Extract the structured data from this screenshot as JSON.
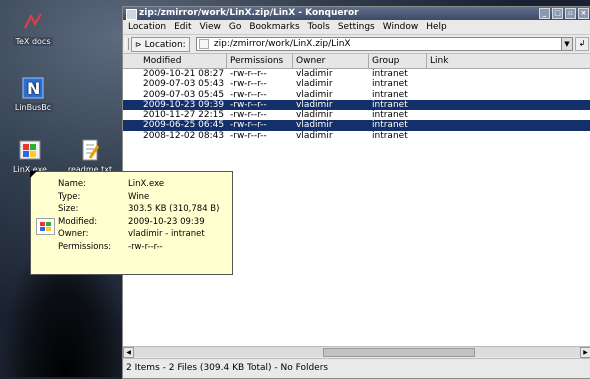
{
  "desktop": {
    "icons": [
      {
        "label": "TeX docs",
        "icon": "tex-docs-icon"
      },
      {
        "label": "LinBusBc",
        "icon": "app-n-icon"
      },
      {
        "label": "LinX.exe",
        "icon": "windows-exe-icon"
      },
      {
        "label": "readme.txt",
        "icon": "text-file-icon"
      }
    ]
  },
  "window": {
    "title": "zip:/zmirror/work/LinX.zip/LinX - Konqueror",
    "menu": [
      "Location",
      "Edit",
      "View",
      "Go",
      "Bookmarks",
      "Tools",
      "Settings",
      "Window",
      "Help"
    ],
    "location_label": "Location:",
    "location_value": "zip:/zmirror/work/LinX.zip/LinX",
    "columns": [
      "Modified",
      "Permissions",
      "Owner",
      "Group",
      "Link"
    ],
    "rows": [
      {
        "modified": "2009-10-21 08:27",
        "permissions": "-rw-r--r--",
        "owner": "vladimir",
        "group": "intranet",
        "link": "",
        "selected": false
      },
      {
        "modified": "2009-07-03 05:43",
        "permissions": "-rw-r--r--",
        "owner": "vladimir",
        "group": "intranet",
        "link": "",
        "selected": false
      },
      {
        "modified": "2009-07-03 05:45",
        "permissions": "-rw-r--r--",
        "owner": "vladimir",
        "group": "intranet",
        "link": "",
        "selected": false
      },
      {
        "modified": "2009-10-23 09:39",
        "permissions": "-rw-r--r--",
        "owner": "vladimir",
        "group": "intranet",
        "link": "",
        "selected": true
      },
      {
        "modified": "2010-11-27 22:15",
        "permissions": "-rw-r--r--",
        "owner": "vladimir",
        "group": "intranet",
        "link": "",
        "selected": false
      },
      {
        "modified": "2009-06-25 06:45",
        "permissions": "-rw-r--r--",
        "owner": "vladimir",
        "group": "intranet",
        "link": "",
        "selected": true
      },
      {
        "modified": "2008-12-02 08:43",
        "permissions": "-rw-r--r--",
        "owner": "vladimir",
        "group": "intranet",
        "link": "",
        "selected": false
      }
    ],
    "status": "2 Items - 2 Files (309.4 KB Total) - No Folders"
  },
  "tooltip": {
    "fields": [
      {
        "key": "Name:",
        "value": "LinX.exe"
      },
      {
        "key": "Type:",
        "value": "Wine"
      },
      {
        "key": "Size:",
        "value": "303.5 KB (310,784 B)"
      },
      {
        "key": "Modified:",
        "value": "2009-10-23 09:39"
      },
      {
        "key": "Owner:",
        "value": "vladimir - intranet"
      },
      {
        "key": "Permissions:",
        "value": "-rw-r--r--"
      }
    ]
  },
  "colors": {
    "selection": "#14306a",
    "tooltip_bg": "#ffffcf",
    "titlebar": "#4a5878"
  }
}
